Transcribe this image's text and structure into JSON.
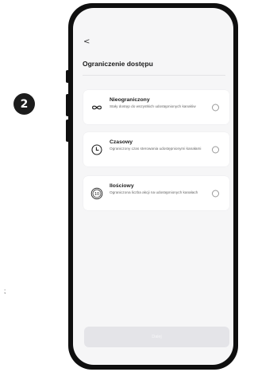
{
  "step_badge": "2",
  "stray_mark": ";",
  "header": {
    "back_glyph": "<",
    "title": "Ograniczenie dostępu"
  },
  "options": [
    {
      "icon": "infinity-icon",
      "name": "Nieograniczony",
      "description": "Stały dostęp do wszystkich udostępnionych kanałów"
    },
    {
      "icon": "clock-icon",
      "name": "Czasowy",
      "description": "Ograniczony czas sterowania udostępnionymi kanałami"
    },
    {
      "icon": "counter-icon",
      "name": "Ilościowy",
      "description": "Ograniczona liczba akcji na udostępnionych kanałach"
    }
  ],
  "counter_icon_label": "10",
  "footer": {
    "next_label": "Dalej"
  }
}
